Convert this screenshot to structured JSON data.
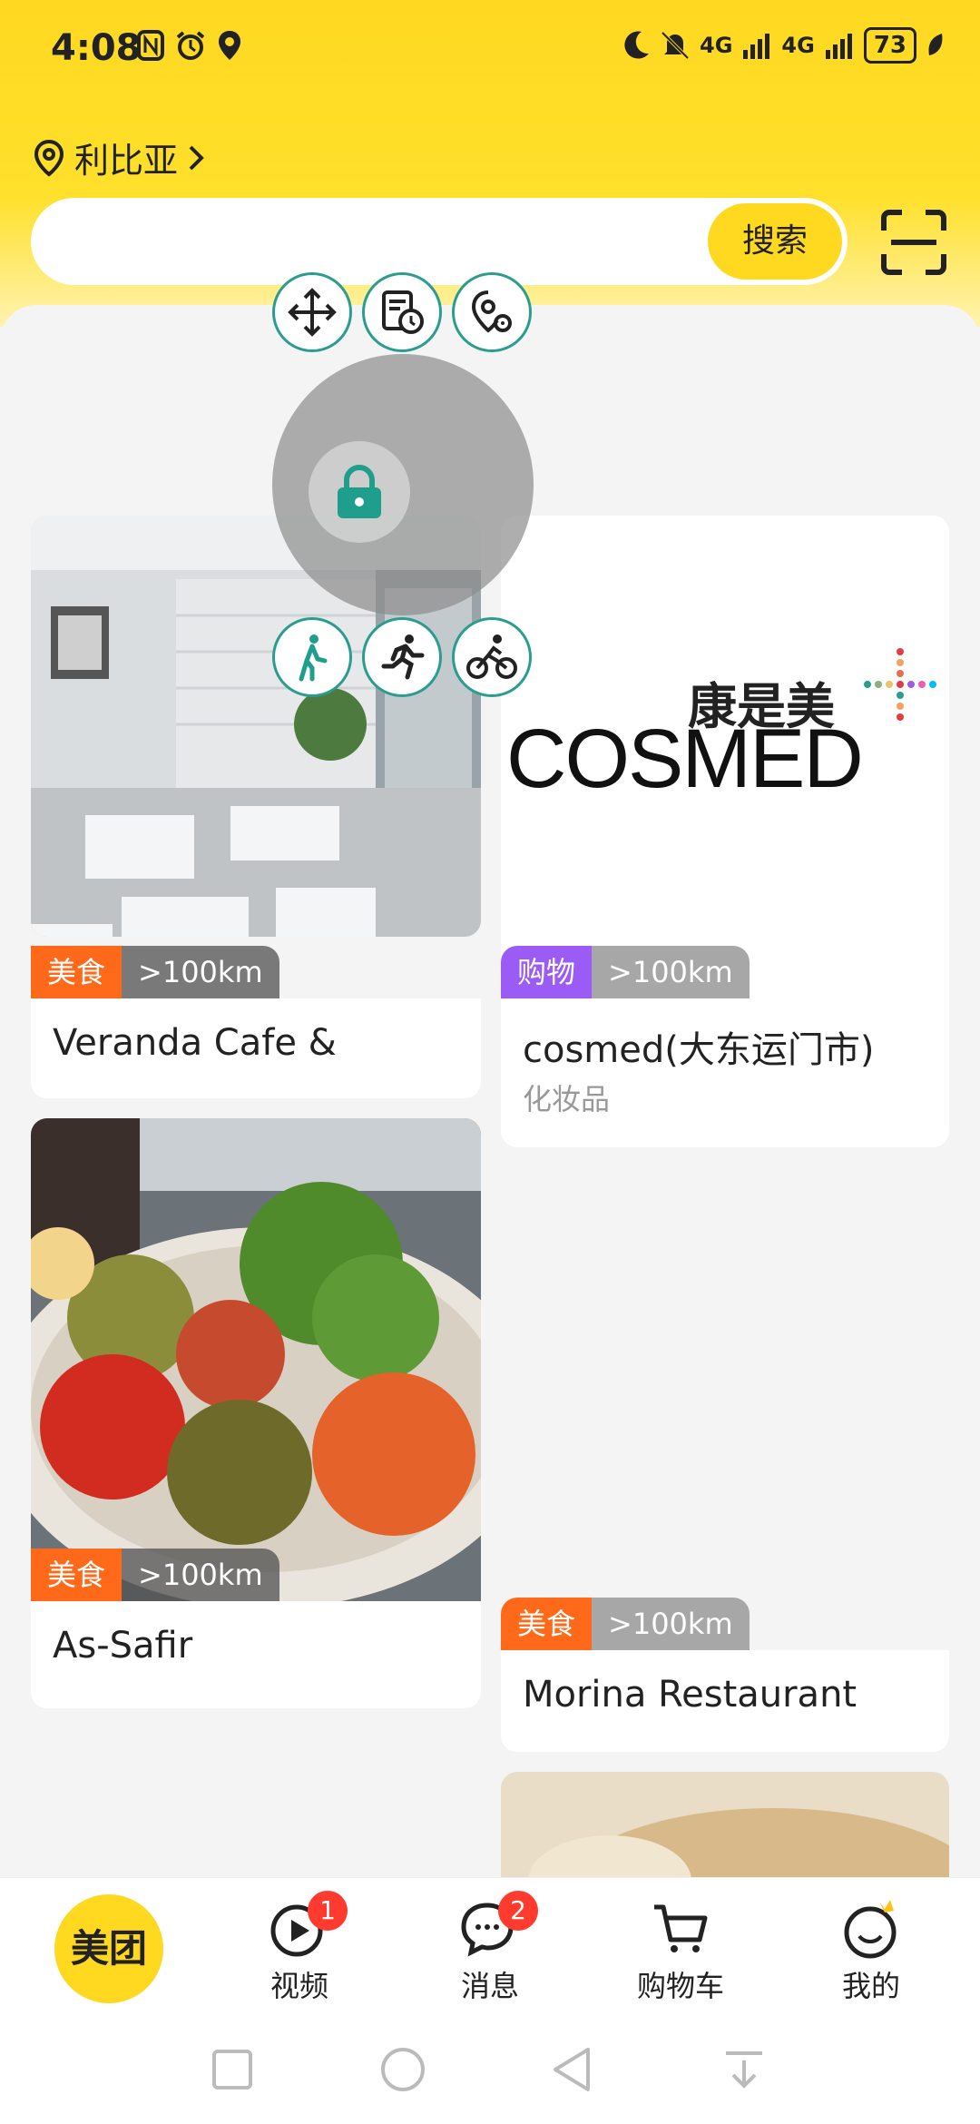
{
  "status_bar": {
    "time": "4:08",
    "battery": "73",
    "network_1": "4G",
    "network_2": "4G"
  },
  "header": {
    "location": "利比亚",
    "search_placeholder": "",
    "search_button": "搜索"
  },
  "overlay": {
    "icons": [
      "move-icon",
      "history-doc-icon",
      "location-settings-icon",
      "lock-icon",
      "walk-icon",
      "run-icon",
      "bike-icon"
    ]
  },
  "cards": [
    {
      "category": "美食",
      "category_color": "#ff6a1a",
      "distance": ">100km",
      "title": "Veranda Cafe &"
    },
    {
      "category": "购物",
      "category_color": "#9b5cf6",
      "distance": ">100km",
      "title": "cosmed(大东运门市)",
      "subtitle": "化妆品",
      "logo_cn": "康是美",
      "logo_en": "COSMED"
    },
    {
      "category": "美食",
      "category_color": "#ff6a1a",
      "distance": ">100km",
      "title": "As-Safir"
    },
    {
      "category": "美食",
      "category_color": "#ff6a1a",
      "distance": ">100km",
      "title": "Morina Restaurant"
    }
  ],
  "bottom_nav": {
    "home": "美团",
    "items": [
      {
        "label": "视频",
        "badge": "1"
      },
      {
        "label": "消息",
        "badge": "2"
      },
      {
        "label": "购物车",
        "badge": ""
      },
      {
        "label": "我的",
        "badge": ""
      }
    ]
  }
}
